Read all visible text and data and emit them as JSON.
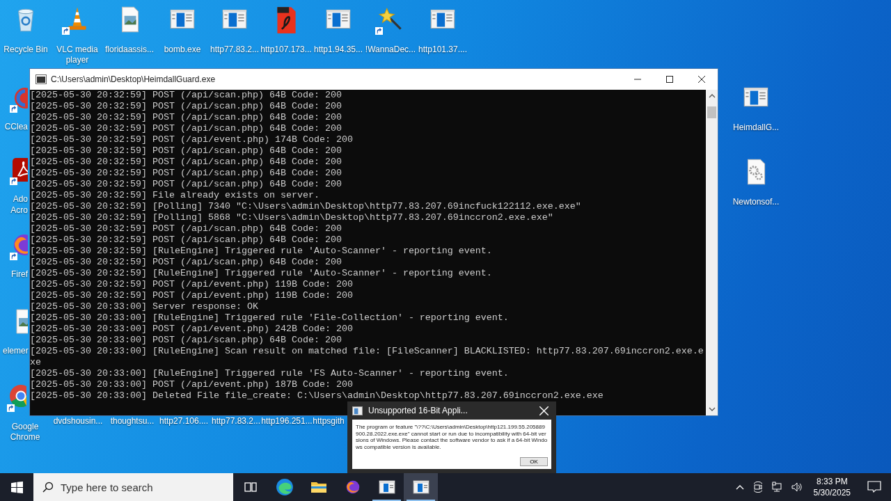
{
  "desktop": {
    "top_row": [
      {
        "label": "Recycle Bin",
        "kind": "bin",
        "shortcut": false
      },
      {
        "label": "VLC media player",
        "kind": "cone",
        "shortcut": true
      },
      {
        "label": "floridaassis...",
        "kind": "image",
        "shortcut": false
      },
      {
        "label": "bomb.exe",
        "kind": "app",
        "shortcut": false
      },
      {
        "label": "http77.83.2...",
        "kind": "app",
        "shortcut": false
      },
      {
        "label": "http107.173...",
        "kind": "pdf",
        "shortcut": false
      },
      {
        "label": "http1.94.35...",
        "kind": "app",
        "shortcut": false
      },
      {
        "label": "!WannaDec...",
        "kind": "wand",
        "shortcut": true
      },
      {
        "label": "http101.37....",
        "kind": "app",
        "shortcut": false
      }
    ],
    "left_column": [
      {
        "label": "CClea",
        "kind": "brush",
        "shortcut": true
      },
      {
        "label": "Ado Acro",
        "kind": "acrobat",
        "shortcut": true
      },
      {
        "label": "Firef",
        "kind": "firefox",
        "shortcut": true
      },
      {
        "label": "elemer",
        "kind": "image",
        "shortcut": false
      }
    ],
    "bottom_row": [
      {
        "label": "Google Chrome",
        "kind": "chrome",
        "shortcut": true
      },
      {
        "label": "dvdshousin...",
        "kind": "hidden"
      },
      {
        "label": "thoughtsu...",
        "kind": "hidden"
      },
      {
        "label": "http27.106....",
        "kind": "hidden"
      },
      {
        "label": "http77.83.2...",
        "kind": "hidden"
      },
      {
        "label": "http196.251...",
        "kind": "hidden"
      },
      {
        "label": "httpsgith",
        "kind": "hidden"
      }
    ],
    "right_column": [
      {
        "label": "HeimdallG...",
        "kind": "app",
        "shortcut": false
      },
      {
        "label": "Newtonsof...",
        "kind": "gears",
        "shortcut": false
      }
    ]
  },
  "console": {
    "title": "C:\\Users\\admin\\Desktop\\HeimdallGuard.exe",
    "lines": [
      "[2025-05-30 20:32:59] POST (/api/scan.php) 64B Code: 200",
      "[2025-05-30 20:32:59] POST (/api/scan.php) 64B Code: 200",
      "[2025-05-30 20:32:59] POST (/api/scan.php) 64B Code: 200",
      "[2025-05-30 20:32:59] POST (/api/scan.php) 64B Code: 200",
      "[2025-05-30 20:32:59] POST (/api/event.php) 174B Code: 200",
      "[2025-05-30 20:32:59] POST (/api/scan.php) 64B Code: 200",
      "[2025-05-30 20:32:59] POST (/api/scan.php) 64B Code: 200",
      "[2025-05-30 20:32:59] POST (/api/scan.php) 64B Code: 200",
      "[2025-05-30 20:32:59] POST (/api/scan.php) 64B Code: 200",
      "[2025-05-30 20:32:59] File already exists on server.",
      "[2025-05-30 20:32:59] [Polling] 7340 \"C:\\Users\\admin\\Desktop\\http77.83.207.69incfuck122112.exe.exe\"",
      "[2025-05-30 20:32:59] [Polling] 5868 \"C:\\Users\\admin\\Desktop\\http77.83.207.69inccron2.exe.exe\"",
      "[2025-05-30 20:32:59] POST (/api/scan.php) 64B Code: 200",
      "[2025-05-30 20:32:59] POST (/api/scan.php) 64B Code: 200",
      "[2025-05-30 20:32:59] [RuleEngine] Triggered rule 'Auto-Scanner' - reporting event.",
      "[2025-05-30 20:32:59] POST (/api/scan.php) 64B Code: 200",
      "[2025-05-30 20:32:59] [RuleEngine] Triggered rule 'Auto-Scanner' - reporting event.",
      "[2025-05-30 20:32:59] POST (/api/event.php) 119B Code: 200",
      "[2025-05-30 20:32:59] POST (/api/event.php) 119B Code: 200",
      "[2025-05-30 20:33:00] Server response: OK",
      "[2025-05-30 20:33:00] [RuleEngine] Triggered rule 'File-Collection' - reporting event.",
      "[2025-05-30 20:33:00] POST (/api/event.php) 242B Code: 200",
      "[2025-05-30 20:33:00] POST (/api/scan.php) 64B Code: 200",
      "[2025-05-30 20:33:00] [RuleEngine] Scan result on matched file: [FileScanner] BLACKLISTED: http77.83.207.69inccron2.exe.e",
      "xe",
      "[2025-05-30 20:33:00] [RuleEngine] Triggered rule 'FS Auto-Scanner' - reporting event.",
      "[2025-05-30 20:33:00] POST (/api/event.php) 187B Code: 200",
      "[2025-05-30 20:33:00] Deleted File file_create: C:\\Users\\admin\\Desktop\\http77.83.207.69inccron2.exe.exe"
    ]
  },
  "dialog": {
    "title": "Unsupported 16-Bit Appli...",
    "message": "The program or feature \"\\??\\C:\\Users\\admin\\Desktop\\http121.199.55.205889900.28.2022.exe.exe\" cannot start or run due to incompatibility with 64-bit versions of Windows. Please contact the software vendor to ask if a 64-bit Windows compatible version is available.",
    "button": "OK"
  },
  "taskbar": {
    "search": {
      "placeholder": "Type here to search"
    },
    "apps": [
      {
        "kind": "taskview",
        "selected": false
      },
      {
        "kind": "edge",
        "selected": false
      },
      {
        "kind": "folder",
        "selected": false
      },
      {
        "kind": "firefox",
        "selected": false
      },
      {
        "kind": "console",
        "selected": false
      },
      {
        "kind": "console",
        "selected": true
      }
    ],
    "time": "8:33 PM",
    "date": "5/30/2025"
  }
}
